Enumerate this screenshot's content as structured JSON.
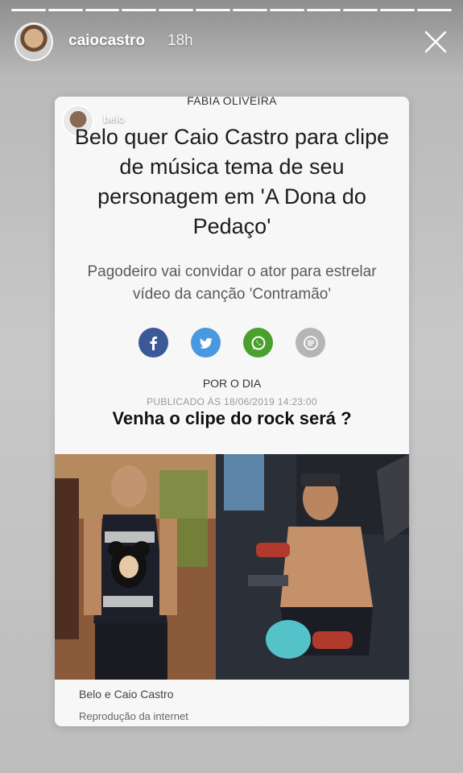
{
  "story": {
    "username": "caiocastro",
    "time": "18h",
    "progress_segments": 12,
    "active_segment": 12
  },
  "article": {
    "author": "FABIA OLIVEIRA",
    "mention": "belo",
    "headline": "Belo quer Caio Castro para clipe de música tema de seu personagem em 'A Dona do Pedaço'",
    "subtitle": "Pagodeiro vai convidar o ator para estrelar vídeo da canção 'Contramão'",
    "byline": "POR O DIA",
    "published": "PUBLICADO ÀS 18/06/2019 14:23:00",
    "overlay_text": "Venha o clipe do rock será ?",
    "photo_caption": "Belo e Caio Castro",
    "photo_credit": "Reprodução da internet",
    "share_icons": [
      "facebook-icon",
      "twitter-icon",
      "whatsapp-icon",
      "comment-icon"
    ]
  },
  "colors": {
    "facebook": "#3b5998",
    "twitter": "#4a98e0",
    "whatsapp": "#4aa02c",
    "comment": "#b5b5b5"
  }
}
